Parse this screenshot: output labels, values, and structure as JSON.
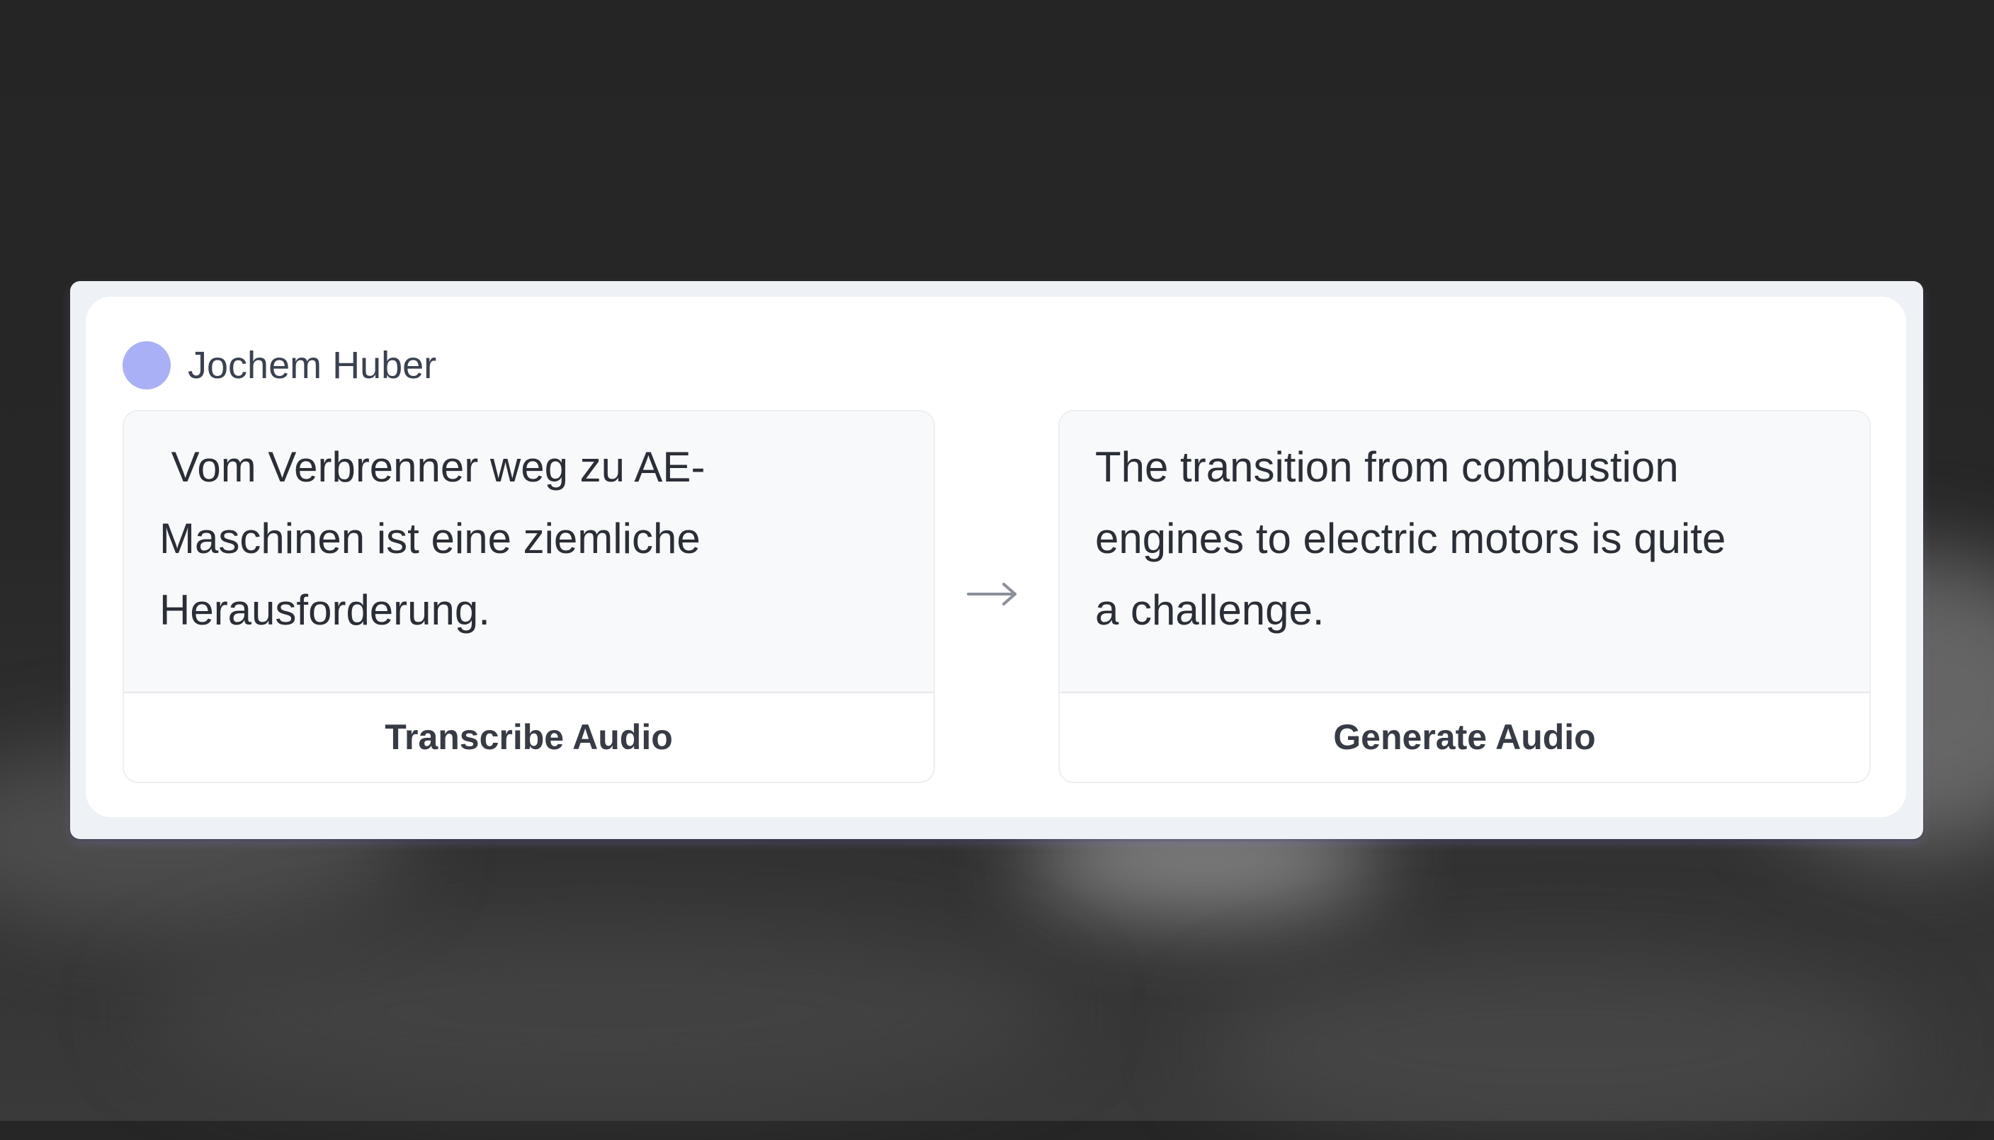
{
  "speaker": {
    "name": "Jochem Huber",
    "avatar_color": "#a9b0f5"
  },
  "source": {
    "text": " Vom Verbrenner weg zu AE-\nMaschinen ist eine ziemliche\nHerausforderung.",
    "action_label": "Transcribe Audio"
  },
  "arrow_icon": "right-arrow-icon",
  "target": {
    "text": "The transition from combustion\nengines to electric motors is quite\na challenge.",
    "action_label": "Generate Audio"
  }
}
